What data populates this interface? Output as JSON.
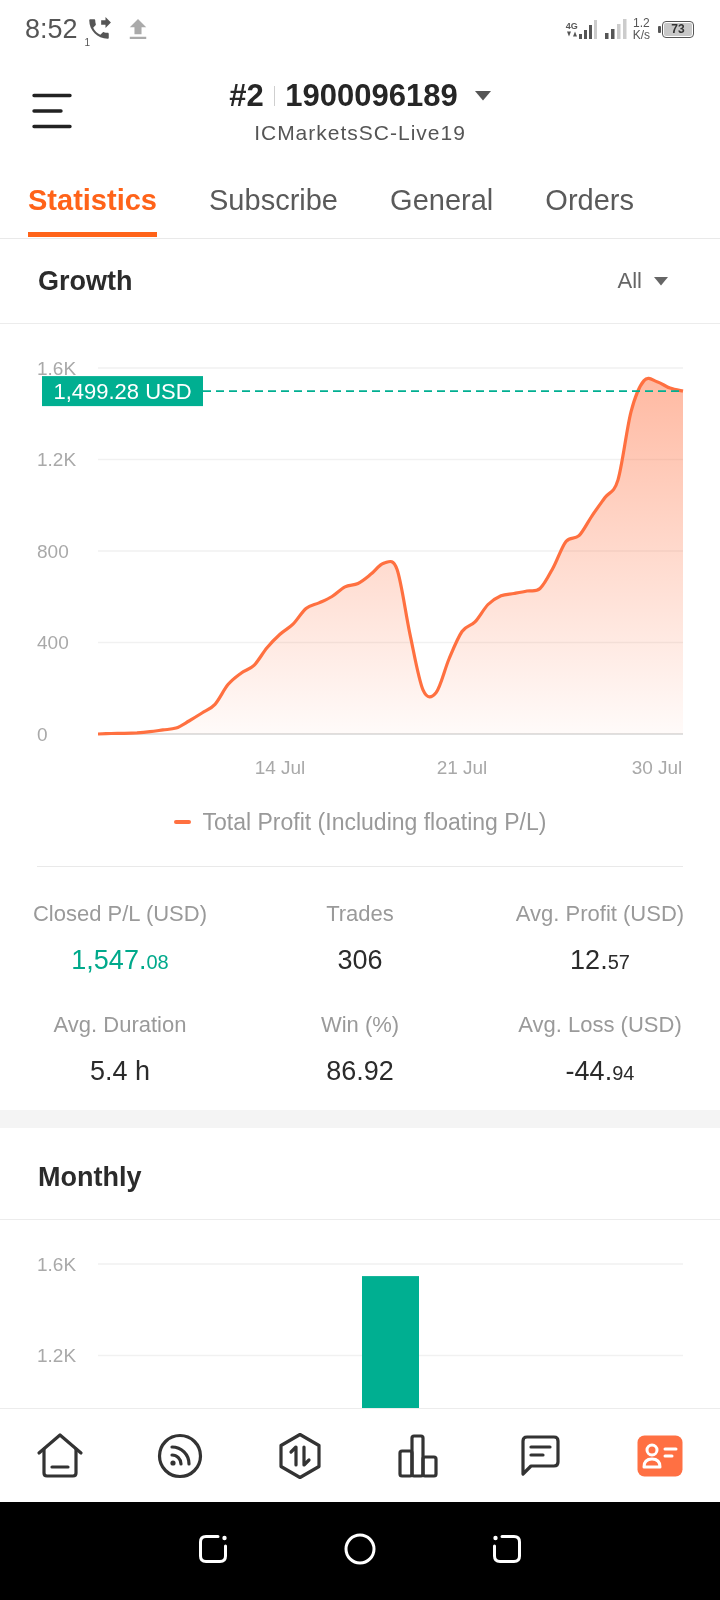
{
  "status_bar": {
    "time": "8:52",
    "sim_slot": "1",
    "network_type": "4G",
    "speed_value": "1.2",
    "speed_unit": "K/s",
    "battery": "73"
  },
  "header": {
    "account_index": "#2",
    "account_number": "1900096189",
    "server": "ICMarketsSC-Live19"
  },
  "tabs": [
    {
      "label": "Statistics",
      "selected": true
    },
    {
      "label": "Subscribe",
      "selected": false
    },
    {
      "label": "General",
      "selected": false
    },
    {
      "label": "Orders",
      "selected": false
    }
  ],
  "growth": {
    "title": "Growth",
    "filter": "All",
    "chart_data": {
      "type": "area",
      "categories": [
        null,
        null,
        null,
        null,
        null,
        null,
        null,
        null,
        null,
        null,
        null,
        null,
        null,
        null,
        "14 Jul",
        null,
        null,
        null,
        null,
        null,
        null,
        null,
        null,
        null,
        null,
        null,
        null,
        null,
        "21 Jul",
        null,
        null,
        null,
        null,
        null,
        null,
        null,
        null,
        null,
        null,
        null,
        null,
        null,
        null,
        "30 Jul",
        null,
        null
      ],
      "series": [
        {
          "name": "Total Profit (Including floating P/L)",
          "color": "#ff7040",
          "values": [
            0,
            2,
            3,
            5,
            10,
            18,
            26,
            57,
            92,
            130,
            216,
            266,
            300,
            377,
            436,
            480,
            549,
            573,
            601,
            643,
            658,
            699,
            747,
            720,
            436,
            193,
            180,
            328,
            448,
            490,
            566,
            604,
            614,
            625,
            636,
            726,
            842,
            867,
            954,
            1034,
            1111,
            1408,
            1545,
            1540,
            1512,
            1499
          ]
        }
      ],
      "ylim": [
        0,
        1600
      ],
      "yticks": [
        {
          "value": 0,
          "label": "0"
        },
        {
          "value": 400,
          "label": "400"
        },
        {
          "value": 800,
          "label": "800"
        },
        {
          "value": 1200,
          "label": "1.2K"
        },
        {
          "value": 1600,
          "label": "1.6K"
        }
      ],
      "grid": true,
      "ref_lines": [
        {
          "axis": "y",
          "value": 1499,
          "label": "1,499.28 USD",
          "color": "#00af91"
        }
      ]
    }
  },
  "stats": [
    {
      "label": "Closed P/L (USD)",
      "value": "1,547.08",
      "small_decimals": true,
      "highlighted": true
    },
    {
      "label": "Trades",
      "value": "306",
      "highlighted": false
    },
    {
      "label": "Avg. Profit (USD)",
      "value": "12.57",
      "small_decimals": true,
      "highlighted": false
    },
    {
      "label": "Avg. Duration",
      "value": "5.4 h",
      "small_decimals": false,
      "highlighted": false
    },
    {
      "label": "Win (%)",
      "value": "86.92",
      "small_decimals": false,
      "highlighted": false
    },
    {
      "label": "Avg. Loss (USD)",
      "value": "-44.94",
      "small_decimals": true,
      "highlighted": false
    }
  ],
  "monthly": {
    "title": "Monthly",
    "chart_data": {
      "type": "bar",
      "series": [
        {
          "color": "#00af91",
          "values": [
            1547
          ]
        }
      ],
      "ylim": [
        970,
        1600
      ],
      "yticks": [
        {
          "value": 1200,
          "label": "1.2K"
        },
        {
          "value": 1600,
          "label": "1.6K"
        }
      ],
      "grid": true
    }
  },
  "bottom_nav": [
    {
      "selected": false
    },
    {
      "selected": false
    },
    {
      "selected": false
    },
    {
      "selected": false
    },
    {
      "selected": false
    },
    {
      "selected": true
    }
  ]
}
